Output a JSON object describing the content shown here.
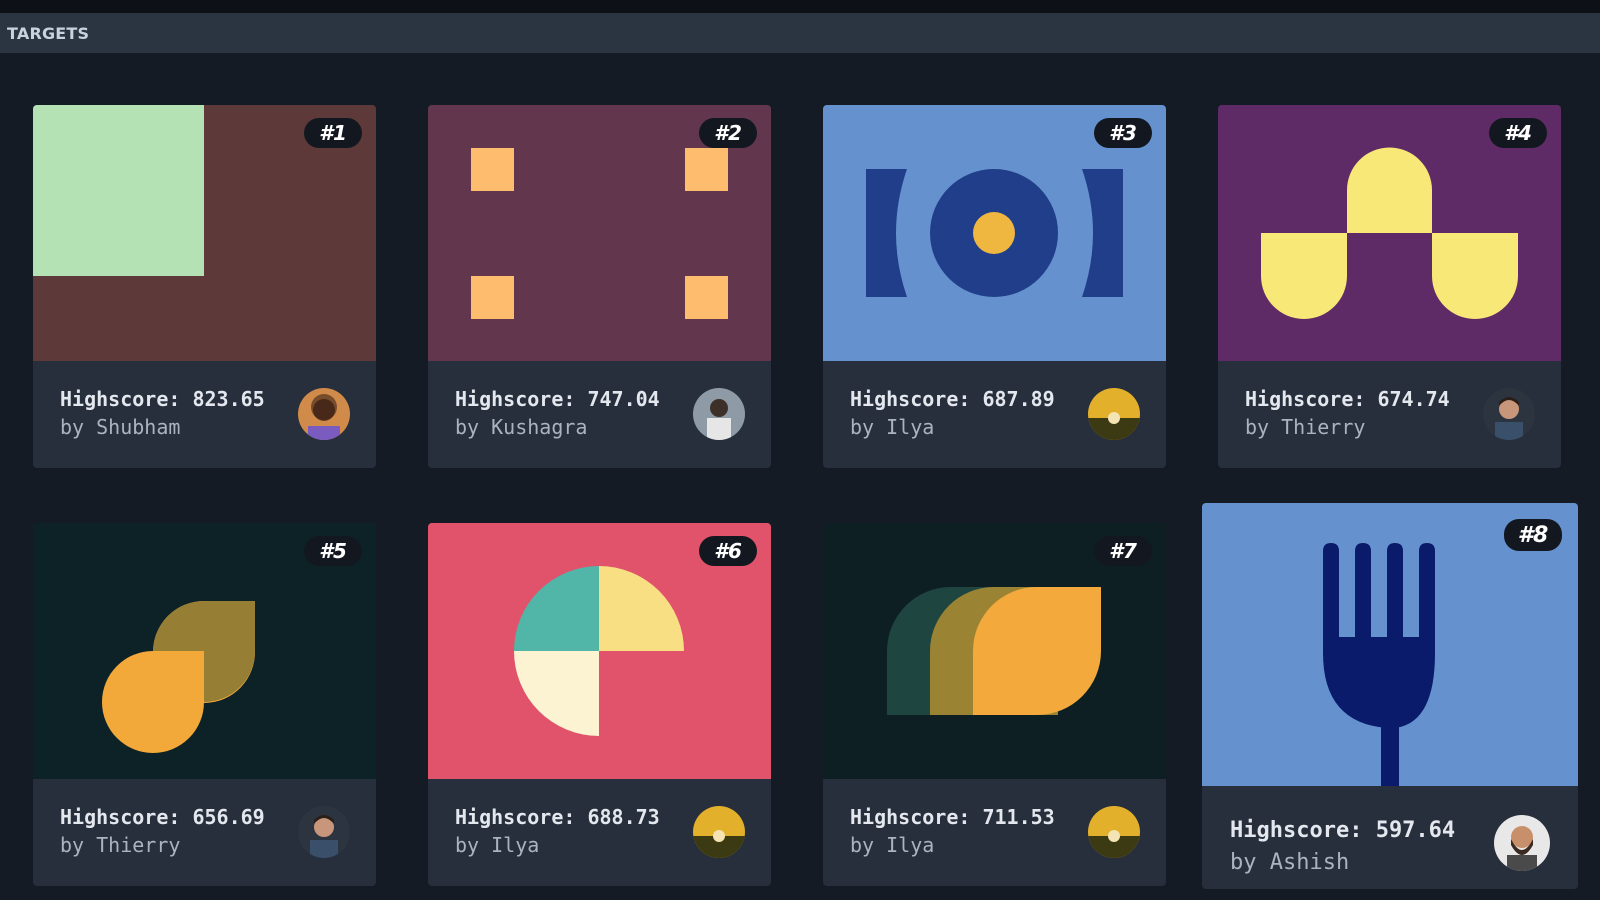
{
  "header": {
    "title": "TARGETS"
  },
  "colors": {
    "page_bg": "#151b24",
    "header_bg": "#2a3541",
    "card_bg": "#262f3b",
    "badge_bg": "#131820"
  },
  "cards": [
    {
      "rank": "#1",
      "score": "Highscore: 823.65",
      "author": "by Shubham"
    },
    {
      "rank": "#2",
      "score": "Highscore: 747.04",
      "author": "by Kushagra"
    },
    {
      "rank": "#3",
      "score": "Highscore: 687.89",
      "author": "by Ilya"
    },
    {
      "rank": "#4",
      "score": "Highscore: 674.74",
      "author": "by Thierry"
    },
    {
      "rank": "#5",
      "score": "Highscore: 656.69",
      "author": "by Thierry"
    },
    {
      "rank": "#6",
      "score": "Highscore: 688.73",
      "author": "by Ilya"
    },
    {
      "rank": "#7",
      "score": "Highscore: 711.53",
      "author": "by Ilya"
    },
    {
      "rank": "#8",
      "score": "Highscore: 597.64",
      "author": "by Ashish"
    }
  ]
}
